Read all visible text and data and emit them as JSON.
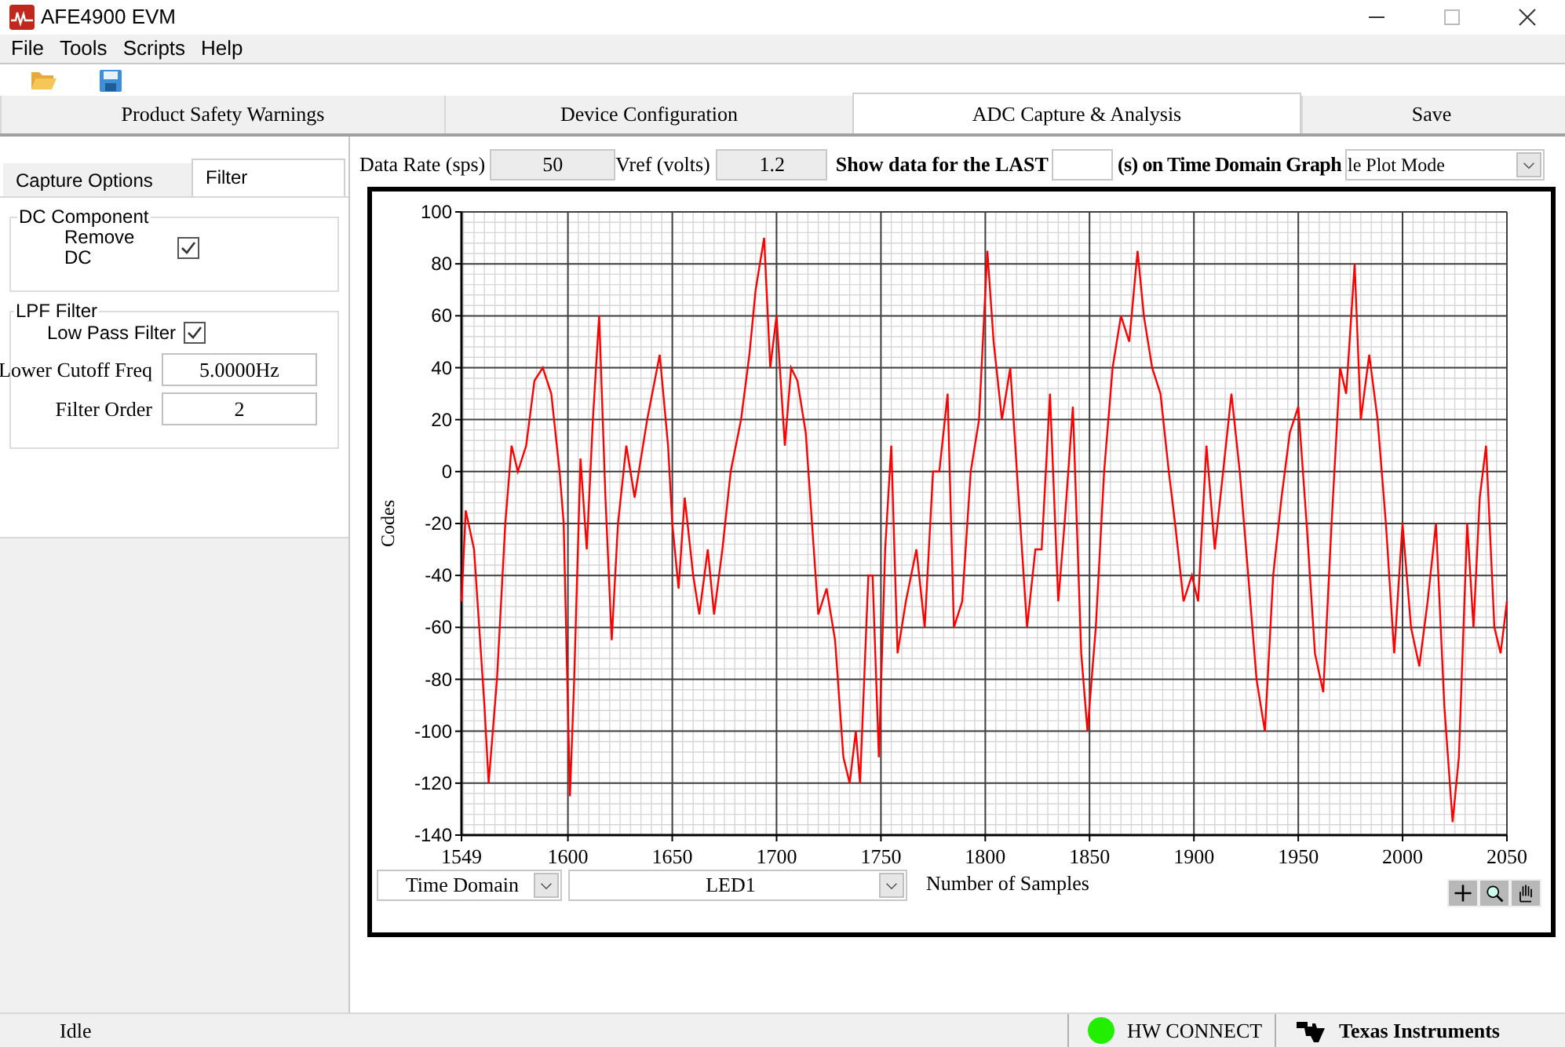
{
  "window": {
    "title": "AFE4900 EVM"
  },
  "menu": [
    "File",
    "Tools",
    "Scripts",
    "Help"
  ],
  "main_tabs": [
    {
      "label": "Product Safety Warnings",
      "selected": false
    },
    {
      "label": "Device Configuration",
      "selected": false
    },
    {
      "label": "ADC Capture & Analysis",
      "selected": true
    },
    {
      "label": "Save",
      "selected": false
    }
  ],
  "side_tabs": [
    {
      "label": "Capture Options",
      "selected": false
    },
    {
      "label": "Filter",
      "selected": true
    }
  ],
  "dc_component": {
    "title": "DC Component",
    "remove_dc": {
      "label": "Remove DC",
      "checked": true
    }
  },
  "lpf_filter": {
    "title": "LPF Filter",
    "low_pass": {
      "label": "Low Pass Filter",
      "checked": true
    },
    "cutoff": {
      "label": "Lower Cutoff Freq",
      "value": "5.0000Hz"
    },
    "order": {
      "label": "Filter Order",
      "value": "2"
    }
  },
  "top_bar": {
    "data_rate": {
      "label": "Data Rate (sps)",
      "value": "50"
    },
    "vref": {
      "label": "Vref (volts)",
      "value": "1.2"
    },
    "show_prefix": "Show data for the LAST",
    "show_suffix": "(s) on Time Domain Graph",
    "plot_mode": "le Plot Mode"
  },
  "graph": {
    "domain": "Time Domain",
    "chart_data": {
      "type": "line",
      "grid": true,
      "xlabel": "Number of Samples",
      "ylabel": "Codes",
      "xlim": [
        1549,
        2050
      ],
      "ylim": [
        -140,
        100
      ],
      "xticks": [
        1549,
        1600,
        1650,
        1700,
        1750,
        1800,
        1850,
        1900,
        1950,
        2000,
        2050
      ],
      "yticks": [
        -140,
        -120,
        -100,
        -80,
        -60,
        -40,
        -20,
        0,
        20,
        40,
        60,
        80,
        100
      ],
      "x": [
        1549,
        1551,
        1555,
        1560,
        1562,
        1566,
        1570,
        1573,
        1576,
        1580,
        1584,
        1588,
        1592,
        1596,
        1598,
        1601,
        1603,
        1606,
        1609,
        1612,
        1615,
        1618,
        1621,
        1624,
        1628,
        1632,
        1638,
        1644,
        1648,
        1650,
        1653,
        1656,
        1660,
        1663,
        1667,
        1670,
        1674,
        1678,
        1683,
        1687,
        1690,
        1694,
        1697,
        1700,
        1704,
        1707,
        1710,
        1714,
        1717,
        1720,
        1724,
        1728,
        1732,
        1735,
        1738,
        1740,
        1744,
        1746,
        1749,
        1752,
        1755,
        1758,
        1762,
        1767,
        1771,
        1775,
        1778,
        1782,
        1785,
        1789,
        1793,
        1797,
        1801,
        1804,
        1808,
        1812,
        1816,
        1820,
        1824,
        1827,
        1831,
        1835,
        1838,
        1842,
        1846,
        1849,
        1853,
        1857,
        1861,
        1865,
        1869,
        1873,
        1876,
        1880,
        1884,
        1888,
        1891,
        1895,
        1899,
        1902,
        1906,
        1910,
        1914,
        1918,
        1922,
        1926,
        1930,
        1934,
        1938,
        1942,
        1946,
        1950,
        1954,
        1958,
        1962,
        1966,
        1970,
        1973,
        1977,
        1980,
        1984,
        1988,
        1992,
        1996,
        2000,
        2004,
        2008,
        2012,
        2016,
        2020,
        2024,
        2027,
        2031,
        2034,
        2037,
        2040,
        2044,
        2047,
        2050
      ],
      "series": [
        {
          "name": "LED1",
          "color": "#ff0000",
          "values": [
            -50,
            -15,
            -30,
            -90,
            -120,
            -80,
            -20,
            10,
            0,
            10,
            35,
            40,
            30,
            0,
            -20,
            -125,
            -80,
            5,
            -30,
            20,
            60,
            -10,
            -65,
            -20,
            10,
            -10,
            20,
            45,
            10,
            -20,
            -45,
            -10,
            -40,
            -55,
            -30,
            -55,
            -30,
            0,
            20,
            45,
            70,
            90,
            40,
            60,
            10,
            40,
            35,
            15,
            -20,
            -55,
            -45,
            -65,
            -110,
            -120,
            -100,
            -120,
            -40,
            -40,
            -110,
            -30,
            10,
            -70,
            -50,
            -30,
            -60,
            0,
            0,
            30,
            -60,
            -50,
            0,
            20,
            85,
            50,
            20,
            40,
            -10,
            -60,
            -30,
            -30,
            30,
            -50,
            -20,
            25,
            -70,
            -100,
            -60,
            0,
            40,
            60,
            50,
            85,
            60,
            40,
            30,
            0,
            -20,
            -50,
            -40,
            -50,
            10,
            -30,
            0,
            30,
            0,
            -40,
            -80,
            -100,
            -40,
            -10,
            15,
            25,
            -20,
            -70,
            -85,
            -20,
            40,
            30,
            80,
            20,
            45,
            20,
            -20,
            -70,
            -20,
            -60,
            -75,
            -50,
            -20,
            -90,
            -135,
            -110,
            -20,
            -60,
            -10,
            10,
            -60,
            -70,
            -50
          ]
        }
      ]
    }
  },
  "status_bar": {
    "state": "Idle",
    "hw_connect": {
      "label": "HW CONNECT",
      "on": true
    },
    "brand": "Texas Instruments"
  }
}
